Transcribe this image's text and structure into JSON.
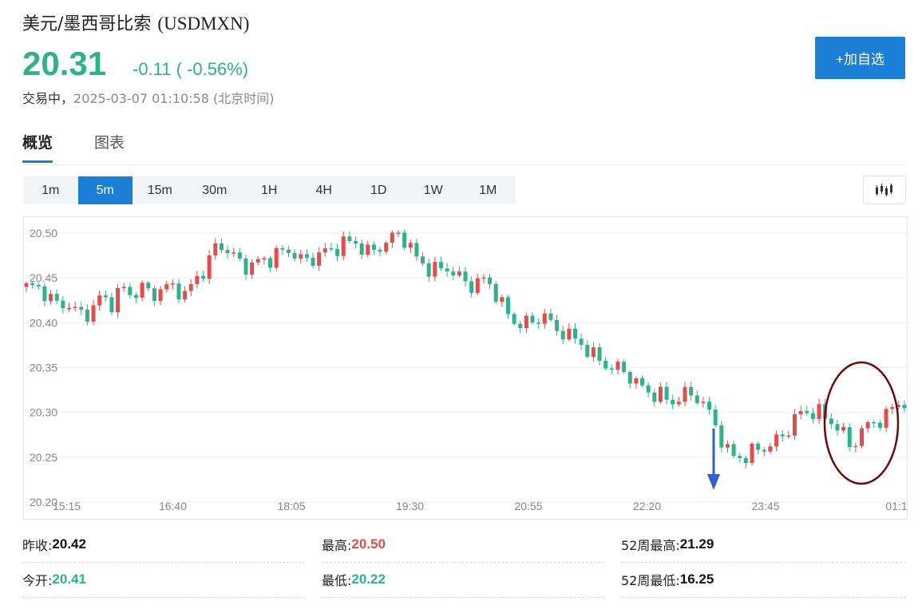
{
  "header": {
    "name": "美元/墨西哥比索",
    "code": "(USDMXN)",
    "price": "20.31",
    "change": "-0.11 ( -0.56%)",
    "status_prefix": "交易中，",
    "datetime": "2025-03-07 01:10:58",
    "timezone": "(北京时间)",
    "add_button": "+加自选"
  },
  "tabs": [
    "概览",
    "图表"
  ],
  "intervals": [
    "1m",
    "5m",
    "15m",
    "30m",
    "1H",
    "4H",
    "1D",
    "1W",
    "1M"
  ],
  "active_interval": "5m",
  "stats": {
    "prev_close_label": "昨收:",
    "prev_close": "20.42",
    "open_label": "今开:",
    "open": "20.41",
    "high_label": "最高:",
    "high": "20.50",
    "low_label": "最低:",
    "low": "20.22",
    "w52_high_label": "52周最高:",
    "w52_high": "21.29",
    "w52_low_label": "52周最低:",
    "w52_low": "16.25"
  },
  "colors": {
    "up": "#e84a4a",
    "down": "#2bb389",
    "accent": "#1a7fd6",
    "annotation_circle": "#6e0a0a",
    "annotation_arrow": "#2f5fd0"
  },
  "chart_data": {
    "type": "candlestick",
    "ylim": [
      20.2,
      20.5
    ],
    "y_ticks": [
      "20.50",
      "20.45",
      "20.40",
      "20.35",
      "20.30",
      "20.25",
      "20.20"
    ],
    "x_ticks": [
      "15:15",
      "16:40",
      "18:05",
      "19:30",
      "20:55",
      "22:20",
      "23:45",
      "01:1"
    ],
    "grid": true,
    "close_path": [
      20.44,
      20.44,
      20.43,
      20.42,
      20.42,
      20.41,
      20.41,
      20.43,
      20.42,
      20.44,
      20.43,
      20.44,
      20.43,
      20.44,
      20.44,
      20.43,
      20.45,
      20.46,
      20.49,
      20.48,
      20.47,
      20.46,
      20.47,
      20.47,
      20.48,
      20.48,
      20.47,
      20.47,
      20.48,
      20.48,
      20.49,
      20.49,
      20.48,
      20.48,
      20.49,
      20.5,
      20.49,
      20.47,
      20.46,
      20.46,
      20.46,
      20.45,
      20.44,
      20.45,
      20.44,
      20.42,
      20.4,
      20.4,
      20.4,
      20.41,
      20.39,
      20.39,
      20.38,
      20.37,
      20.36,
      20.35,
      20.35,
      20.34,
      20.33,
      20.32,
      20.32,
      20.31,
      20.32,
      20.32,
      20.31,
      20.29,
      20.26,
      20.25,
      20.25,
      20.26,
      20.26,
      20.27,
      20.28,
      20.3,
      20.3,
      20.3,
      20.29,
      20.28,
      20.26,
      20.28,
      20.29,
      20.29,
      20.31,
      20.31
    ],
    "annotations": [
      {
        "type": "arrow",
        "near_x": "22:20–23:45",
        "points_to_y": 20.25
      },
      {
        "type": "ellipse",
        "near_x": "23:45–01:1",
        "y_range": [
          20.23,
          20.34
        ]
      }
    ]
  }
}
